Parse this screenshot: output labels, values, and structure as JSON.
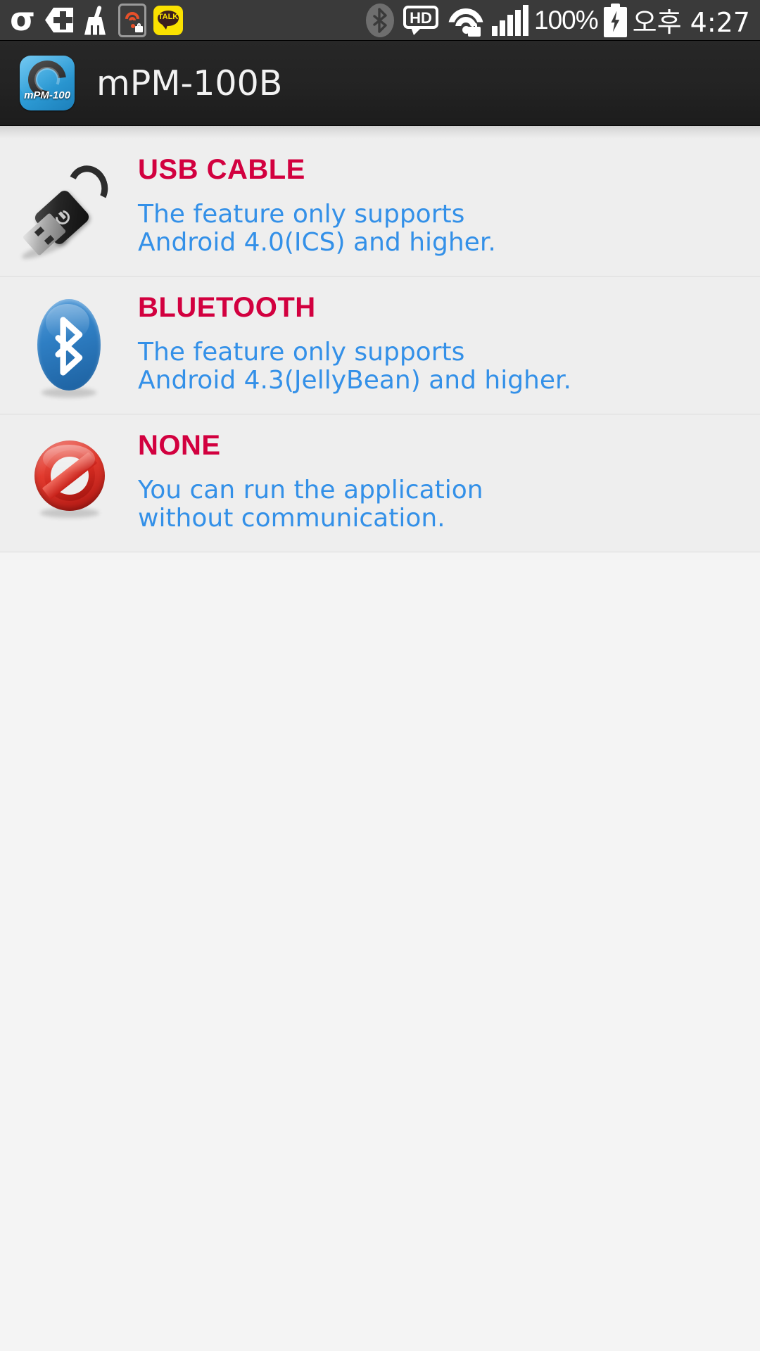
{
  "statusbar": {
    "left_icons": [
      {
        "name": "sigma-app-icon",
        "glyph": "σ"
      },
      {
        "name": "shield-plus-icon"
      },
      {
        "name": "broom-cleaner-icon"
      },
      {
        "name": "phone-wifi-lock-icon"
      },
      {
        "name": "kakaotalk-icon",
        "label": "TALK"
      }
    ],
    "right_icons": [
      {
        "name": "bluetooth-status-icon"
      },
      {
        "name": "hd-voice-icon",
        "label": "HD"
      },
      {
        "name": "wifi-secured-icon"
      },
      {
        "name": "cellular-signal-icon"
      }
    ],
    "battery_percent": "100%",
    "battery_icon": "battery-charging-icon",
    "time": "오후 4:27"
  },
  "titlebar": {
    "app_icon_name": "mpm100-app-icon",
    "app_icon_label": "mPM-100",
    "title": "mPM-100B"
  },
  "list": {
    "items": [
      {
        "id": "usb-cable",
        "icon": "usb-cable-icon",
        "title": "USB CABLE",
        "desc_line1": "The feature only supports",
        "desc_line2": "Android 4.0(ICS) and higher."
      },
      {
        "id": "bluetooth",
        "icon": "bluetooth-icon",
        "title": "BLUETOOTH",
        "desc_line1": "The feature only supports",
        "desc_line2": "Android 4.3(JellyBean) and higher."
      },
      {
        "id": "none",
        "icon": "no-connection-icon",
        "title": "NONE",
        "desc_line1": "You can run the application",
        "desc_line2": "without communication."
      }
    ]
  },
  "colors": {
    "title_red": "#d2003f",
    "desc_blue": "#3390e8",
    "statusbar_bg": "#3a3a3a",
    "titlebar_bg": "#232323",
    "row_bg": "#eeeeee",
    "page_bg": "#f4f4f4"
  }
}
